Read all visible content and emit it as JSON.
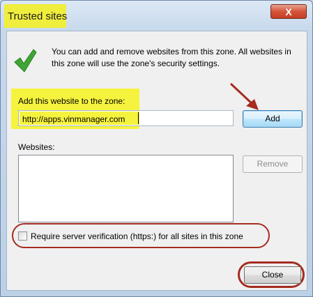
{
  "window": {
    "title": "Trusted sites",
    "close_glyph": "X"
  },
  "info_text": "You can add and remove websites from this zone. All websites in this zone will use the zone's security settings.",
  "add_section": {
    "label": "Add this website to the zone:",
    "url_value": "http://apps.vinmanager.com",
    "add_label": "Add"
  },
  "websites": {
    "label": "Websites:",
    "items": [],
    "remove_label": "Remove"
  },
  "require_https": {
    "label": "Require server verification (https:) for all sites in this zone",
    "checked": false
  },
  "close_label": "Close",
  "icons": {
    "info": "green-checkmark-icon",
    "annotation": "red-arrow-icon"
  },
  "colors": {
    "highlight": "#f6f33e",
    "annotation_red": "#a52c1f",
    "check_green": "#3fa535"
  }
}
